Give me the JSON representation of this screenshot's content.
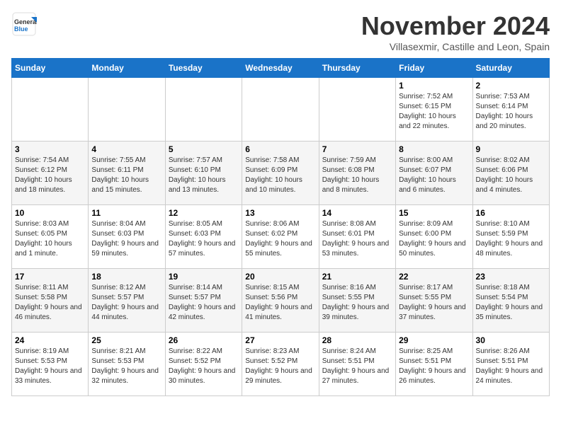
{
  "logo": {
    "general": "General",
    "blue": "Blue"
  },
  "header": {
    "month": "November 2024",
    "location": "Villasexmir, Castille and Leon, Spain"
  },
  "weekdays": [
    "Sunday",
    "Monday",
    "Tuesday",
    "Wednesday",
    "Thursday",
    "Friday",
    "Saturday"
  ],
  "days": [
    {
      "num": "",
      "info": ""
    },
    {
      "num": "",
      "info": ""
    },
    {
      "num": "",
      "info": ""
    },
    {
      "num": "",
      "info": ""
    },
    {
      "num": "",
      "info": ""
    },
    {
      "num": "1",
      "info": "Sunrise: 7:52 AM\nSunset: 6:15 PM\nDaylight: 10 hours and 22 minutes."
    },
    {
      "num": "2",
      "info": "Sunrise: 7:53 AM\nSunset: 6:14 PM\nDaylight: 10 hours and 20 minutes."
    },
    {
      "num": "3",
      "info": "Sunrise: 7:54 AM\nSunset: 6:12 PM\nDaylight: 10 hours and 18 minutes."
    },
    {
      "num": "4",
      "info": "Sunrise: 7:55 AM\nSunset: 6:11 PM\nDaylight: 10 hours and 15 minutes."
    },
    {
      "num": "5",
      "info": "Sunrise: 7:57 AM\nSunset: 6:10 PM\nDaylight: 10 hours and 13 minutes."
    },
    {
      "num": "6",
      "info": "Sunrise: 7:58 AM\nSunset: 6:09 PM\nDaylight: 10 hours and 10 minutes."
    },
    {
      "num": "7",
      "info": "Sunrise: 7:59 AM\nSunset: 6:08 PM\nDaylight: 10 hours and 8 minutes."
    },
    {
      "num": "8",
      "info": "Sunrise: 8:00 AM\nSunset: 6:07 PM\nDaylight: 10 hours and 6 minutes."
    },
    {
      "num": "9",
      "info": "Sunrise: 8:02 AM\nSunset: 6:06 PM\nDaylight: 10 hours and 4 minutes."
    },
    {
      "num": "10",
      "info": "Sunrise: 8:03 AM\nSunset: 6:05 PM\nDaylight: 10 hours and 1 minute."
    },
    {
      "num": "11",
      "info": "Sunrise: 8:04 AM\nSunset: 6:03 PM\nDaylight: 9 hours and 59 minutes."
    },
    {
      "num": "12",
      "info": "Sunrise: 8:05 AM\nSunset: 6:03 PM\nDaylight: 9 hours and 57 minutes."
    },
    {
      "num": "13",
      "info": "Sunrise: 8:06 AM\nSunset: 6:02 PM\nDaylight: 9 hours and 55 minutes."
    },
    {
      "num": "14",
      "info": "Sunrise: 8:08 AM\nSunset: 6:01 PM\nDaylight: 9 hours and 53 minutes."
    },
    {
      "num": "15",
      "info": "Sunrise: 8:09 AM\nSunset: 6:00 PM\nDaylight: 9 hours and 50 minutes."
    },
    {
      "num": "16",
      "info": "Sunrise: 8:10 AM\nSunset: 5:59 PM\nDaylight: 9 hours and 48 minutes."
    },
    {
      "num": "17",
      "info": "Sunrise: 8:11 AM\nSunset: 5:58 PM\nDaylight: 9 hours and 46 minutes."
    },
    {
      "num": "18",
      "info": "Sunrise: 8:12 AM\nSunset: 5:57 PM\nDaylight: 9 hours and 44 minutes."
    },
    {
      "num": "19",
      "info": "Sunrise: 8:14 AM\nSunset: 5:57 PM\nDaylight: 9 hours and 42 minutes."
    },
    {
      "num": "20",
      "info": "Sunrise: 8:15 AM\nSunset: 5:56 PM\nDaylight: 9 hours and 41 minutes."
    },
    {
      "num": "21",
      "info": "Sunrise: 8:16 AM\nSunset: 5:55 PM\nDaylight: 9 hours and 39 minutes."
    },
    {
      "num": "22",
      "info": "Sunrise: 8:17 AM\nSunset: 5:55 PM\nDaylight: 9 hours and 37 minutes."
    },
    {
      "num": "23",
      "info": "Sunrise: 8:18 AM\nSunset: 5:54 PM\nDaylight: 9 hours and 35 minutes."
    },
    {
      "num": "24",
      "info": "Sunrise: 8:19 AM\nSunset: 5:53 PM\nDaylight: 9 hours and 33 minutes."
    },
    {
      "num": "25",
      "info": "Sunrise: 8:21 AM\nSunset: 5:53 PM\nDaylight: 9 hours and 32 minutes."
    },
    {
      "num": "26",
      "info": "Sunrise: 8:22 AM\nSunset: 5:52 PM\nDaylight: 9 hours and 30 minutes."
    },
    {
      "num": "27",
      "info": "Sunrise: 8:23 AM\nSunset: 5:52 PM\nDaylight: 9 hours and 29 minutes."
    },
    {
      "num": "28",
      "info": "Sunrise: 8:24 AM\nSunset: 5:51 PM\nDaylight: 9 hours and 27 minutes."
    },
    {
      "num": "29",
      "info": "Sunrise: 8:25 AM\nSunset: 5:51 PM\nDaylight: 9 hours and 26 minutes."
    },
    {
      "num": "30",
      "info": "Sunrise: 8:26 AM\nSunset: 5:51 PM\nDaylight: 9 hours and 24 minutes."
    }
  ]
}
